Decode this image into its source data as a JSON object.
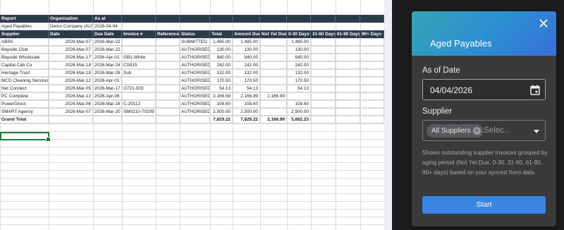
{
  "sheet": {
    "meta_headers": [
      "Report",
      "Organisation",
      "As at"
    ],
    "meta_values": [
      "Aged Payables",
      "Demo Company (AU)",
      "2026-04-04"
    ],
    "columns": [
      "Supplier",
      "Date",
      "Due Date",
      "Invoice #",
      "Reference",
      "Status",
      "Total",
      "Amount Due",
      "Not Yet Due",
      "0-30 Days",
      "31-60 Days",
      "61-90 Days",
      "90+ Days"
    ],
    "rows": [
      [
        "ABPA",
        "2026-Mar-07",
        "2026-Mar-22",
        "",
        "",
        "SUBMITTED",
        "1,485.00",
        "1,485.00",
        "",
        "1,485.00",
        "",
        "",
        ""
      ],
      [
        "Bayside Club",
        "2026-Mar-07",
        "2026-Mar-22",
        "",
        "",
        "AUTHORISED",
        "130.00",
        "130.00",
        "",
        "130.00",
        "",
        "",
        ""
      ],
      [
        "Bayside Wholesale",
        "2026-Mar-17",
        "2026-Apr-01",
        "GB1-White",
        "",
        "AUTHORISED",
        "840.00",
        "840.00",
        "",
        "840.00",
        "",
        "",
        ""
      ],
      [
        "Capital Cab Co",
        "2026-Mar-18",
        "2026-Mar-24",
        "CS815",
        "",
        "AUTHORISED",
        "242.00",
        "242.00",
        "",
        "242.00",
        "",
        "",
        ""
      ],
      [
        "Heritage Trust",
        "2026-Mar-18",
        "2026-Mar-26",
        "Sub",
        "",
        "AUTHORISED",
        "132.00",
        "132.00",
        "",
        "132.00",
        "",
        "",
        ""
      ],
      [
        "MCD Cleaning Services",
        "2026-Mar-12",
        "2026-Apr-01",
        "",
        "",
        "AUTHORISED",
        "170.50",
        "170.50",
        "",
        "170.50",
        "",
        "",
        ""
      ],
      [
        "Net Connect",
        "2026-Mar-05",
        "2026-Mar-17",
        "O721-003",
        "",
        "AUTHORISED",
        "54.13",
        "54.13",
        "",
        "54.13",
        "",
        "",
        ""
      ],
      [
        "PC Complete",
        "2026-Mar-12",
        "2026-Apr-06",
        "",
        "",
        "AUTHORISED",
        "2,166.99",
        "2,166.99",
        "2,166.99",
        "",
        "",
        "",
        ""
      ],
      [
        "PowerDirect",
        "2026-Mar-06",
        "2026-Mar-16",
        "C-20112",
        "",
        "AUTHORISED",
        "108.60",
        "108.60",
        "",
        "108.60",
        "",
        "",
        ""
      ],
      [
        "SMART Agency",
        "2026-Mar-07",
        "2026-Mar-20",
        "SM0210-70209",
        "",
        "AUTHORISED",
        "2,500.00",
        "2,500.00",
        "",
        "2,500.00",
        "",
        "",
        ""
      ]
    ],
    "grand_total": [
      "Grand Total",
      "",
      "",
      "",
      "",
      "",
      "7,829.22",
      "7,829.22",
      "2,166.99",
      "5,662.23",
      "",
      "",
      ""
    ]
  },
  "panel": {
    "title": "Aged Payables",
    "as_of_label": "As of Date",
    "as_of_value": "04/04/2026",
    "supplier_label": "Supplier",
    "supplier_chip": "All Suppliers",
    "supplier_placeholder": "Selec...",
    "help_text": "Shows outstanding supplier invoices grouped by aging period (Not Yet Due, 0-30, 31-60, 61-90, 90+ days) based on your synced Xero data.",
    "start_label": "Start"
  },
  "icons": [
    "close-icon",
    "calendar-icon",
    "chip-remove-icon",
    "chevron-down-icon"
  ],
  "colors": {
    "header_bg": "#2d3a4a",
    "panel_gradient_start": "#34a4b6",
    "panel_gradient_end": "#3a6fd8",
    "start_button": "#3a86e0",
    "selection": "#1e7b34"
  }
}
